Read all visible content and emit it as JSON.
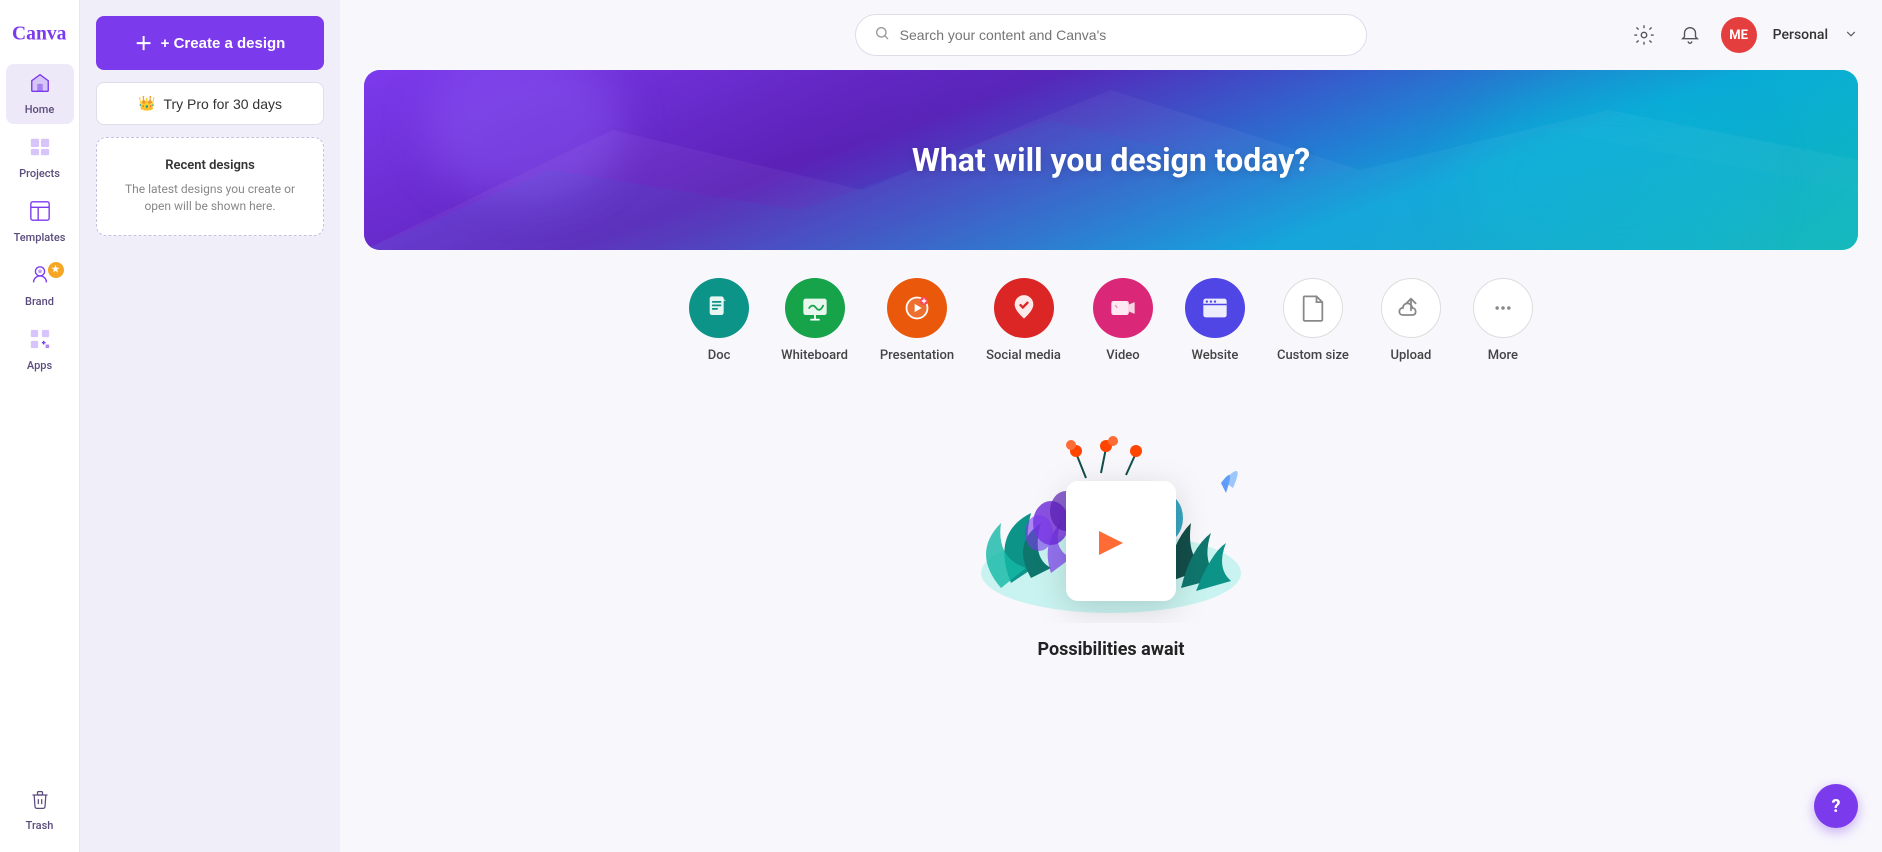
{
  "app": {
    "logo_text": "Canva"
  },
  "sidebar": {
    "items": [
      {
        "id": "home",
        "label": "Home",
        "icon": "🏠",
        "active": true
      },
      {
        "id": "projects",
        "label": "Projects",
        "icon": "📁"
      },
      {
        "id": "templates",
        "label": "Templates",
        "icon": "⬜"
      },
      {
        "id": "brand",
        "label": "Brand",
        "icon": "🎭",
        "badge": "★"
      },
      {
        "id": "apps",
        "label": "Apps",
        "icon": "⊞"
      }
    ],
    "trash": {
      "label": "Trash"
    }
  },
  "left_panel": {
    "create_button": "+ Create a design",
    "try_pro_button": "Try Pro for 30 days",
    "recent_designs": {
      "title": "Recent designs",
      "description": "The latest designs you create or open will be shown here."
    }
  },
  "header": {
    "search_placeholder": "Search your content and Canva's",
    "user": {
      "initials": "ME",
      "name": "Personal"
    }
  },
  "hero": {
    "title": "What will you design today?"
  },
  "design_types": [
    {
      "id": "doc",
      "label": "Doc",
      "icon_class": "icon-doc",
      "icon": "📄"
    },
    {
      "id": "whiteboard",
      "label": "Whiteboard",
      "icon_class": "icon-whiteboard",
      "icon": "🖊"
    },
    {
      "id": "presentation",
      "label": "Presentation",
      "icon_class": "icon-presentation",
      "icon": "🎯"
    },
    {
      "id": "social-media",
      "label": "Social media",
      "icon_class": "icon-social",
      "icon": "❤"
    },
    {
      "id": "video",
      "label": "Video",
      "icon_class": "icon-video",
      "icon": "▶"
    },
    {
      "id": "website",
      "label": "Website",
      "icon_class": "icon-website",
      "icon": "🖥"
    },
    {
      "id": "custom-size",
      "label": "Custom size",
      "icon_class": "icon-custom",
      "icon": "✂"
    },
    {
      "id": "upload",
      "label": "Upload",
      "icon_class": "icon-upload",
      "icon": "☁"
    },
    {
      "id": "more",
      "label": "More",
      "icon_class": "icon-more",
      "icon": "···"
    }
  ],
  "possibilities": {
    "title": "Possibilities await"
  },
  "help_button": "?"
}
